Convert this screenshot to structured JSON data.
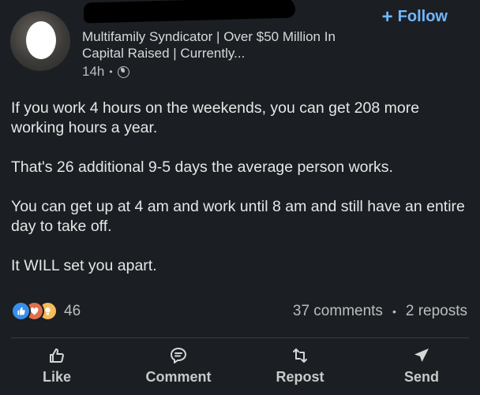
{
  "author": {
    "headline": "Multifamily Syndicator | Over $50 Million In Capital Raised | Currently...",
    "time": "14h",
    "dot": "•"
  },
  "follow": {
    "icon": "+",
    "label": "Follow"
  },
  "post": {
    "paragraphs": [
      "If you work 4 hours on the weekends, you can get 208 more working hours a year.",
      "That's 26 additional 9-5 days the average person works.",
      "You can get up at 4 am and work until 8 am and still have an entire day to take off.",
      "It WILL set you apart."
    ]
  },
  "social": {
    "reaction_count": "46",
    "comments": "37 comments",
    "separator": "•",
    "reposts": "2 reposts"
  },
  "actions": {
    "like": "Like",
    "comment": "Comment",
    "repost": "Repost",
    "send": "Send"
  },
  "colors": {
    "background": "#1b1f23",
    "accent": "#71b7fb",
    "like": "#378fe9",
    "love": "#df704d",
    "insight": "#f5bb5c"
  }
}
